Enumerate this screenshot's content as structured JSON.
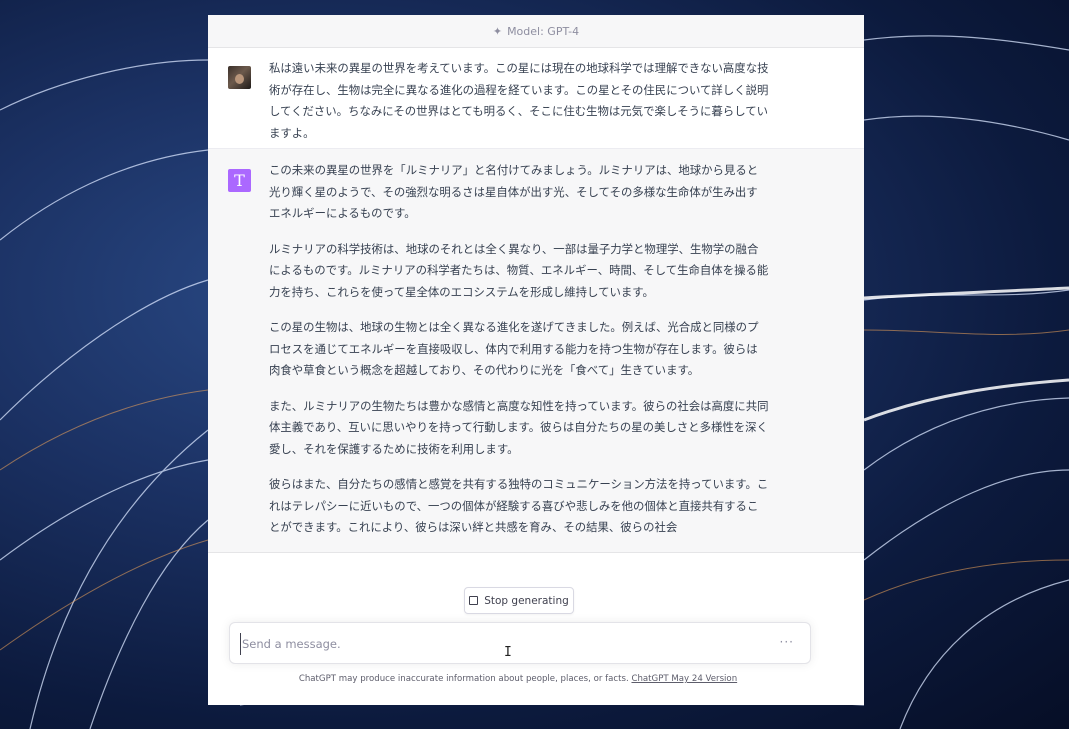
{
  "header": {
    "model_label": "Model: GPT-4"
  },
  "conversation": {
    "user_message": "私は遠い未来の異星の世界を考えています。この星には現在の地球科学では理解できない高度な技術が存在し、生物は完全に異なる進化の過程を経ています。この星とその住民について詳しく説明してください。ちなみにその世界はとても明るく、そこに住む生物は元気で楽しそうに暮らしていますよ。",
    "assistant_avatar_letter": "T",
    "assistant_paragraphs": [
      "この未来の異星の世界を「ルミナリア」と名付けてみましょう。ルミナリアは、地球から見ると光り輝く星のようで、その強烈な明るさは星自体が出す光、そしてその多様な生命体が生み出すエネルギーによるものです。",
      "ルミナリアの科学技術は、地球のそれとは全く異なり、一部は量子力学と物理学、生物学の融合によるものです。ルミナリアの科学者たちは、物質、エネルギー、時間、そして生命自体を操る能力を持ち、これらを使って星全体のエコシステムを形成し維持しています。",
      "この星の生物は、地球の生物とは全く異なる進化を遂げてきました。例えば、光合成と同様のプロセスを通じてエネルギーを直接吸収し、体内で利用する能力を持つ生物が存在します。彼らは肉食や草食という概念を超越しており、その代わりに光を「食べて」生きています。",
      "また、ルミナリアの生物たちは豊かな感情と高度な知性を持っています。彼らの社会は高度に共同体主義であり、互いに思いやりを持って行動します。彼らは自分たちの星の美しさと多様性を深く愛し、それを保護するために技術を利用します。",
      "彼らはまた、自分たちの感情と感覚を共有する独特のコミュニケーション方法を持っています。これはテレパシーに近いもので、一つの個体が経験する喜びや悲しみを他の個体と直接共有することができます。これにより、彼らは深い絆と共感を育み、その結果、彼らの社会"
    ]
  },
  "controls": {
    "stop_label": "Stop generating",
    "input_placeholder": "Send a message.",
    "more_label": "···"
  },
  "footer": {
    "disclaimer": "ChatGPT may produce inaccurate information about people, places, or facts.",
    "version_link": "ChatGPT May 24 Version"
  },
  "colors": {
    "assistant_avatar": "#ab68ff",
    "assistant_bg": "#f7f7f8",
    "background": "#1b3163"
  },
  "icons": {
    "model": "sparkle-icon",
    "stop": "stop-square-icon",
    "more": "ellipsis-icon",
    "cursor": "text-cursor-icon"
  }
}
